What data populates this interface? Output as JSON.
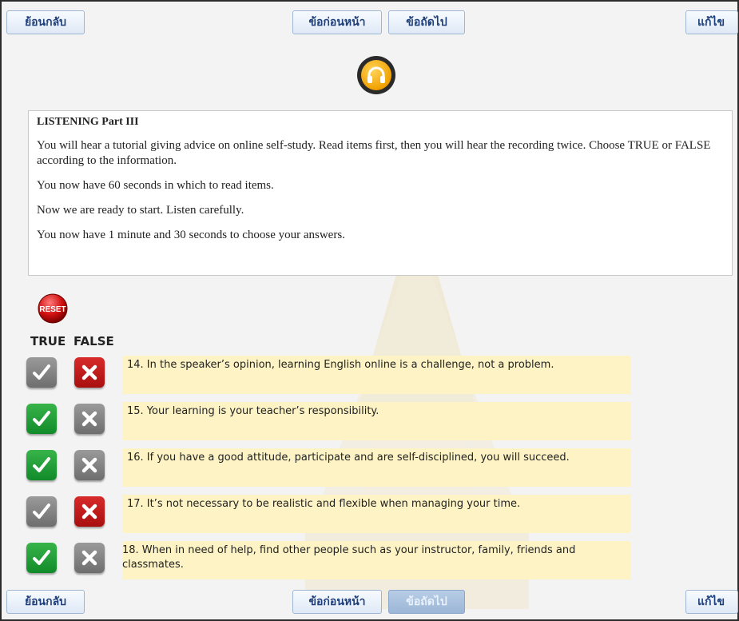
{
  "nav": {
    "back": "ย้อนกลับ",
    "prev": "ข้อก่อนหน้า",
    "next": "ข้อถัดไป",
    "edit": "แก้ไข"
  },
  "audio": {
    "icon": "headphones-icon"
  },
  "instructions": {
    "title": "LISTENING Part III",
    "paragraphs": [
      "You will hear a tutorial giving advice on online self-study.  Read items first, then you will hear the recording twice. Choose TRUE or FALSE according to the information.",
      "You now have 60 seconds in which to read items.",
      "Now we are ready to start.  Listen carefully.",
      "You now have 1 minute and 30 seconds to choose your answers."
    ]
  },
  "reset_label": "RESET",
  "headers": {
    "true": "TRUE",
    "false": "FALSE"
  },
  "questions": [
    {
      "text": "14. In the speaker’s opinion, learning English online is a challenge, not a problem.",
      "answer": "false"
    },
    {
      "text": "15. Your learning is your teacher’s responsibility.",
      "answer": "true"
    },
    {
      "text": "16. If you have a good attitude, participate and are self-disciplined, you will succeed.",
      "answer": "true"
    },
    {
      "text": "17. It’s not necessary to be realistic and flexible when managing your time.",
      "answer": "false"
    },
    {
      "text": " 18. When in need of help, find other people such as your instructor, family, friends and classmates.",
      "answer": "true"
    }
  ],
  "colors": {
    "selected_true": "#1a9a33",
    "selected_false": "#c01818",
    "unselected": "#808080",
    "question_bg": "#fdf3c4"
  }
}
